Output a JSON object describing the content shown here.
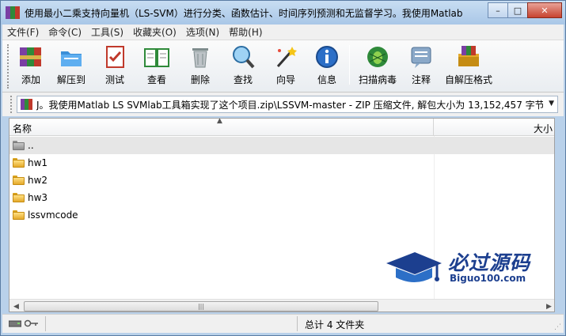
{
  "window": {
    "title": "使用最小二乘支持向量机（LS-SVM）进行分类、函数估计、时间序列预测和无监督学习。我使用Matlab"
  },
  "menu": [
    "文件(F)",
    "命令(C)",
    "工具(S)",
    "收藏夹(O)",
    "选项(N)",
    "帮助(H)"
  ],
  "toolbar": [
    {
      "label": "添加",
      "icon": "add-archive-icon"
    },
    {
      "label": "解压到",
      "icon": "extract-to-icon"
    },
    {
      "label": "测试",
      "icon": "test-icon"
    },
    {
      "label": "查看",
      "icon": "view-icon"
    },
    {
      "label": "删除",
      "icon": "delete-icon"
    },
    {
      "label": "查找",
      "icon": "find-icon"
    },
    {
      "label": "向导",
      "icon": "wizard-icon"
    },
    {
      "label": "信息",
      "icon": "info-icon"
    },
    {
      "label": "扫描病毒",
      "icon": "virus-scan-icon"
    },
    {
      "label": "注释",
      "icon": "comment-icon"
    },
    {
      "label": "自解压格式",
      "icon": "sfx-icon"
    }
  ],
  "address": {
    "path": "J。我使用Matlab LS SVMlab工具箱实现了这个项目.zip\\LSSVM-master - ZIP 压缩文件, 解包大小为 13,152,457 字节"
  },
  "columns": {
    "name": "名称",
    "size": "大小"
  },
  "files": [
    {
      "name": "..",
      "type": "parent"
    },
    {
      "name": "hw1",
      "type": "folder"
    },
    {
      "name": "hw2",
      "type": "folder"
    },
    {
      "name": "hw3",
      "type": "folder"
    },
    {
      "name": "lssvmcode",
      "type": "folder"
    }
  ],
  "watermark": {
    "cn": "必过源码",
    "en": "Biguo100.com"
  },
  "status": {
    "summary": "总计 4 文件夹"
  },
  "colors": {
    "accent": "#1c3f8f",
    "selection": "#e6e6e6"
  }
}
